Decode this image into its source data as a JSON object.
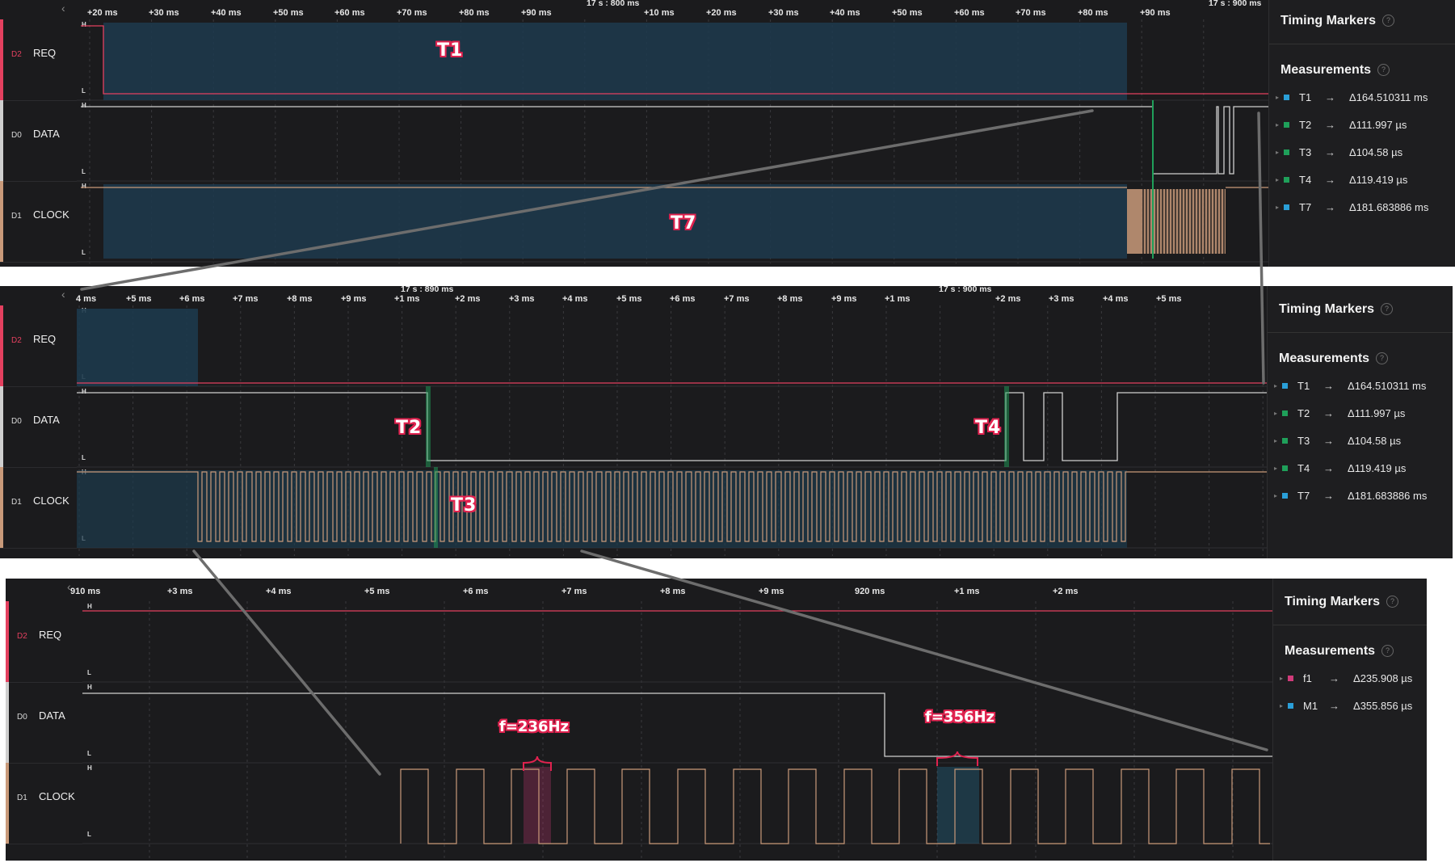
{
  "colors": {
    "req": "#e4405f",
    "data": "#cfcfcf",
    "clock": "#c99a7a",
    "t1": "#2a9fd8",
    "t2": "#1fa05a",
    "f1": "#d03b7a",
    "m1": "#2a9fd8",
    "overlay": "#1d3a4d"
  },
  "channel_numbers": [
    "D2",
    "D0",
    "D1"
  ],
  "channels": {
    "req": "REQ",
    "data": "DATA",
    "clock": "CLOCK"
  },
  "levels": {
    "high": "H",
    "low": "L"
  },
  "sidebar": {
    "timing_markers": "Timing Markers",
    "measurements": "Measurements",
    "help": "?"
  },
  "panel1": {
    "ticks": [
      "+20 ms",
      "+30 ms",
      "+40 ms",
      "+50 ms",
      "+60 ms",
      "+70 ms",
      "+80 ms",
      "+90 ms",
      "+10 ms",
      "+20 ms",
      "+30 ms",
      "+40 ms",
      "+50 ms",
      "+60 ms",
      "+70 ms",
      "+80 ms",
      "+90 ms"
    ],
    "header_labels": [
      "17 s : 800 ms",
      "17 s : 900 ms"
    ],
    "measurements": [
      {
        "name": "T1",
        "arrow": "→",
        "value": "Δ164.510311 ms",
        "color": "#2a9fd8"
      },
      {
        "name": "T2",
        "arrow": "→",
        "value": "Δ111.997 µs",
        "color": "#1fa05a"
      },
      {
        "name": "T3",
        "arrow": "→",
        "value": "Δ104.58 µs",
        "color": "#1fa05a"
      },
      {
        "name": "T4",
        "arrow": "→",
        "value": "Δ119.419 µs",
        "color": "#1fa05a"
      },
      {
        "name": "T7",
        "arrow": "→",
        "value": "Δ181.683886 ms",
        "color": "#2a9fd8"
      }
    ],
    "annotations": [
      "T1",
      "T7"
    ]
  },
  "panel2": {
    "ticks": [
      "4 ms",
      "+5 ms",
      "+6 ms",
      "+7 ms",
      "+8 ms",
      "+9 ms",
      "+1 ms",
      "+2 ms",
      "+3 ms",
      "+4 ms",
      "+5 ms",
      "+6 ms",
      "+7 ms",
      "+8 ms",
      "+9 ms",
      "+1 ms",
      "+2 ms",
      "+3 ms",
      "+4 ms",
      "+5 ms"
    ],
    "header_labels": [
      "17 s : 890 ms",
      "17 s : 900 ms"
    ],
    "measurements": [
      {
        "name": "T1",
        "arrow": "→",
        "value": "Δ164.510311 ms",
        "color": "#2a9fd8"
      },
      {
        "name": "T2",
        "arrow": "→",
        "value": "Δ111.997 µs",
        "color": "#1fa05a"
      },
      {
        "name": "T3",
        "arrow": "→",
        "value": "Δ104.58 µs",
        "color": "#1fa05a"
      },
      {
        "name": "T4",
        "arrow": "→",
        "value": "Δ119.419 µs",
        "color": "#1fa05a"
      },
      {
        "name": "T7",
        "arrow": "→",
        "value": "Δ181.683886 ms",
        "color": "#2a9fd8"
      }
    ],
    "annotations": [
      "T2",
      "T4",
      "T3"
    ]
  },
  "panel3": {
    "ticks": [
      "910 ms",
      "+3 ms",
      "+4 ms",
      "+5 ms",
      "+6 ms",
      "+7 ms",
      "+8 ms",
      "+9 ms",
      "920 ms",
      "+1 ms",
      "+2 ms"
    ],
    "measurements": [
      {
        "name": "f1",
        "arrow": "→",
        "value": "Δ235.908 µs",
        "color": "#d03b7a"
      },
      {
        "name": "M1",
        "arrow": "→",
        "value": "Δ355.856 µs",
        "color": "#2a9fd8"
      }
    ],
    "annotations": [
      "f=236Hz",
      "f=356Hz"
    ]
  }
}
